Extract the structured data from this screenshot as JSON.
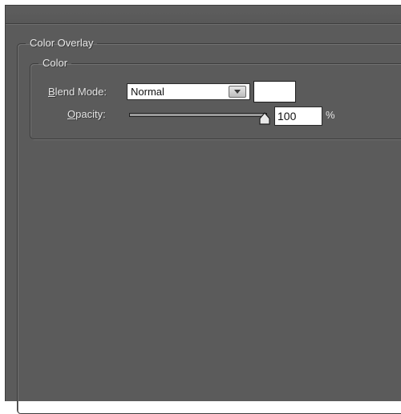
{
  "panel": {
    "title": "Color Overlay"
  },
  "color_group": {
    "title": "Color",
    "blend_mode": {
      "label_mnemonic": "B",
      "label_rest": "lend Mode:",
      "value": "Normal"
    },
    "swatch_color": "#ffffff",
    "opacity": {
      "label_mnemonic": "O",
      "label_rest": "pacity:",
      "value": "100",
      "unit": "%",
      "slider_fraction": 1.0
    }
  },
  "icons": {
    "dropdown": "chevron-down-icon",
    "slider": "slider-thumb-icon"
  },
  "colors": {
    "panel_bg": "#5b5b5b",
    "text": "#e4e4e4"
  }
}
